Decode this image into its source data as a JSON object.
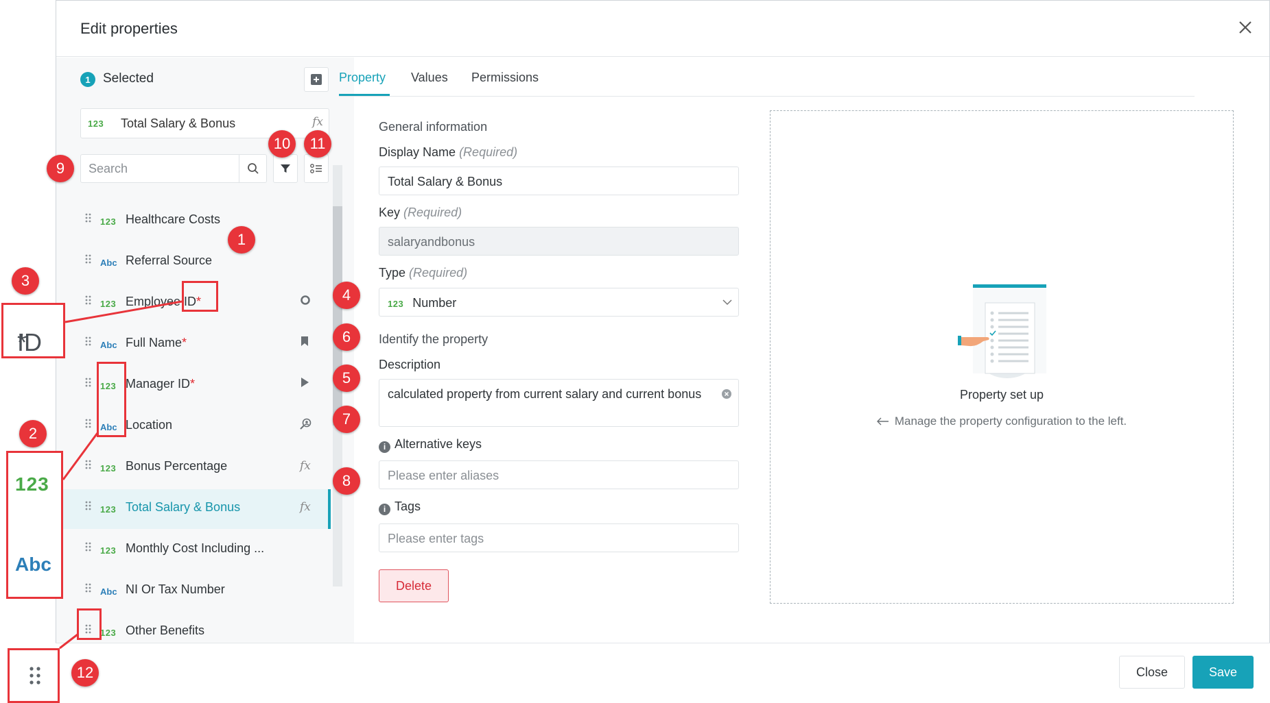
{
  "modal": {
    "title": "Edit properties"
  },
  "selected": {
    "count": "1",
    "label": "Selected",
    "item_type": "123",
    "item_name": "Total Salary & Bonus",
    "item_icon": "fx"
  },
  "search": {
    "placeholder": "Search"
  },
  "list": [
    {
      "type": "123",
      "name": "Healthcare Costs",
      "required": false,
      "icon": ""
    },
    {
      "type": "Abc",
      "name": "Referral Source",
      "required": false,
      "icon": ""
    },
    {
      "type": "123",
      "name": "Employee ID",
      "required": true,
      "icon": "circle"
    },
    {
      "type": "Abc",
      "name": "Full Name",
      "required": true,
      "icon": "bookmark"
    },
    {
      "type": "123",
      "name": "Manager ID",
      "required": true,
      "icon": "play"
    },
    {
      "type": "Abc",
      "name": "Location",
      "required": false,
      "icon": "search-person"
    },
    {
      "type": "123",
      "name": "Bonus Percentage",
      "required": false,
      "icon": "fx"
    },
    {
      "type": "123",
      "name": "Total Salary & Bonus",
      "required": false,
      "icon": "fx",
      "active": true
    },
    {
      "type": "123",
      "name": "Monthly Cost Including ...",
      "required": false,
      "icon": ""
    },
    {
      "type": "Abc",
      "name": "NI Or Tax Number",
      "required": false,
      "icon": ""
    },
    {
      "type": "123",
      "name": "Other Benefits",
      "required": false,
      "icon": ""
    }
  ],
  "tabs": [
    "Property",
    "Values",
    "Permissions"
  ],
  "form": {
    "general_info": "General information",
    "display_name_label": "Display Name",
    "required_hint": "(Required)",
    "display_name_value": "Total Salary & Bonus",
    "key_label": "Key",
    "key_value": "salaryandbonus",
    "type_label": "Type",
    "type_badge": "123",
    "type_value": "Number",
    "identify": "Identify the property",
    "description_label": "Description",
    "description_value": "calculated property from current salary and current bonus",
    "alt_keys_label": "Alternative keys",
    "alt_keys_placeholder": "Please enter aliases",
    "tags_label": "Tags",
    "tags_placeholder": "Please enter tags",
    "delete": "Delete"
  },
  "setup": {
    "title": "Property set up",
    "subtitle": "Manage the property configuration to the left."
  },
  "footer": {
    "close": "Close",
    "save": "Save"
  },
  "annotations": {
    "zoom_id": "ID",
    "zoom_123": "123",
    "zoom_abc": "Abc",
    "callouts": [
      "1",
      "2",
      "3",
      "4",
      "5",
      "6",
      "7",
      "8",
      "9",
      "10",
      "11",
      "12"
    ]
  },
  "colors": {
    "accent": "#17a2b8",
    "number_type": "#4aaa48",
    "text_type": "#2d7fb8",
    "required": "#e0282e",
    "callout": "#e8343a"
  }
}
